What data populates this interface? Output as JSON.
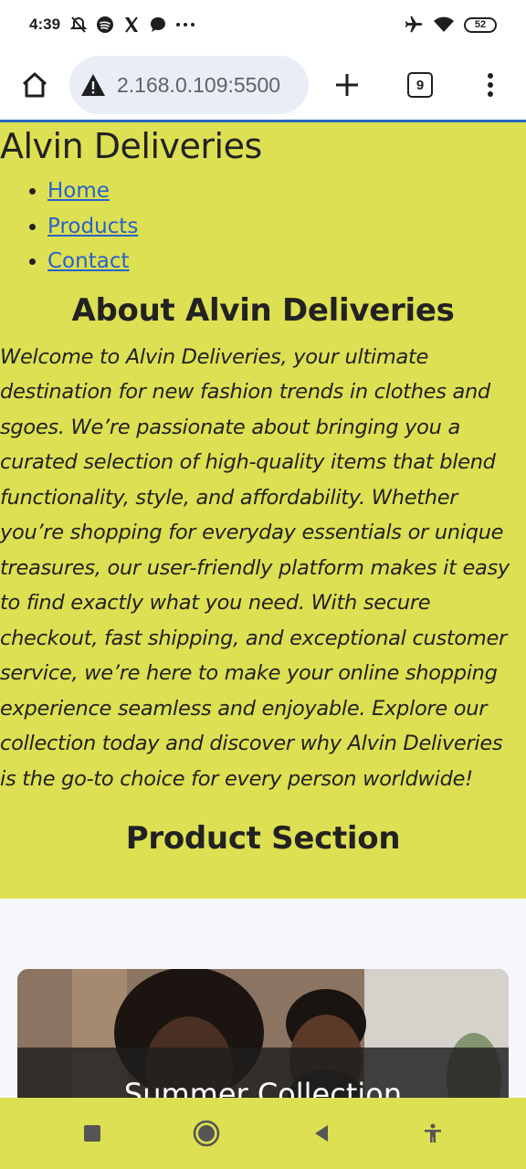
{
  "status_bar": {
    "time": "4:39",
    "battery": "52",
    "icons_left": [
      "mute-icon",
      "spotify-icon",
      "x-icon",
      "message-icon",
      "more-icon"
    ],
    "icons_right": [
      "airplane-icon",
      "wifi-icon",
      "battery-icon"
    ]
  },
  "browser": {
    "url": "2.168.0.109:5500",
    "tab_count": "9"
  },
  "site": {
    "title": "Alvin Deliveries",
    "nav": [
      {
        "label": "Home"
      },
      {
        "label": "Products"
      },
      {
        "label": "Contact"
      }
    ],
    "about_title": "About Alvin Deliveries",
    "about_text": "Welcome to Alvin Deliveries, your ultimate destination for new fashion trends in clothes and sgoes. We’re passionate about bringing you a curated selection of high-quality items that blend functionality, style, and affordability. Whether you’re shopping for everyday essentials or unique treasures, our user-friendly platform makes it easy to find exactly what you need. With secure checkout, fast shipping, and exceptional customer service, we’re here to make your online shopping experience seamless and enjoyable. Explore our collection today and discover why Alvin Deliveries is the go-to choice for every person worldwide!",
    "product_title": "Product Section",
    "product_card_title": "Summer Collection"
  },
  "colors": {
    "page_bg": "#dde052",
    "link": "#2a62c8",
    "progress": "#2a64c2"
  }
}
